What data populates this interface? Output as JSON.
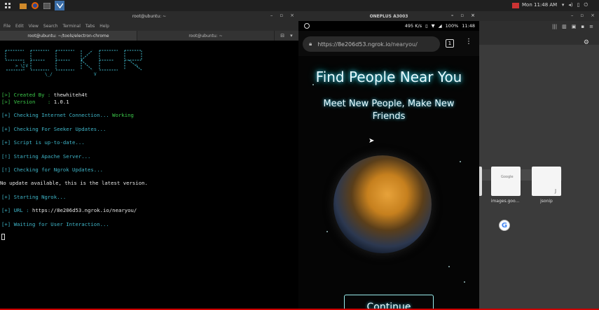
{
  "topbar": {
    "clock": "Mon 11:48 AM",
    "icons": [
      "apps-icon",
      "files-icon",
      "firefox-icon",
      "terminal-icon",
      "vpn-icon"
    ],
    "system_icons": [
      "network-icon",
      "volume-icon",
      "battery-icon",
      "power-icon"
    ]
  },
  "terminal": {
    "title": "root@ubuntu: ~",
    "menu": [
      "File",
      "Edit",
      "View",
      "Search",
      "Terminal",
      "Tabs",
      "Help"
    ],
    "tabs": [
      "root@ubuntu: ~/tools/electron-chrome",
      "root@ubuntu: ~"
    ],
    "banner": "seeker",
    "lines": [
      {
        "prefix": "[>]",
        "text": " Created By : ",
        "value": "thewhiteh4t",
        "color": "#3cc94a"
      },
      {
        "prefix": "[>]",
        "text": " Version    : ",
        "value": "1.0.1",
        "color": "#3cc94a"
      },
      {
        "prefix": "[+]",
        "text": " Checking Internet Connection... ",
        "value": "Working",
        "color": "#3fb6c9"
      },
      {
        "prefix": "[+]",
        "text": " Checking For Seeker Updates...",
        "value": "",
        "color": "#3fb6c9"
      },
      {
        "prefix": "[+]",
        "text": " Script is up-to-date...",
        "value": "",
        "color": "#3fb6c9"
      },
      {
        "prefix": "[!]",
        "text": " Starting Apache Server...",
        "value": "",
        "color": "#3fb6c9"
      },
      {
        "prefix": "[!]",
        "text": " Checking for Ngrok Updates...",
        "value": "",
        "color": "#3fb6c9"
      },
      {
        "prefix": "",
        "text": "No update available, this is the latest version.",
        "value": "",
        "color": "#e8e8e8"
      },
      {
        "prefix": "[+]",
        "text": " Starting Ngrok...",
        "value": "",
        "color": "#3fb6c9"
      },
      {
        "prefix": "[+]",
        "text": " URL : ",
        "value": "https://8e206d53.ngrok.io/nearyou/",
        "color": "#3fb6c9"
      },
      {
        "prefix": "[+]",
        "text": " Waiting for User Interaction...",
        "value": "",
        "color": "#3fb6c9"
      }
    ]
  },
  "phone": {
    "title": "ONEPLUS A3003",
    "status": {
      "speed": "495 K/s",
      "battery": "100%",
      "time": "11:48"
    },
    "url_host": "https://8e206d53.ngrok.io",
    "url_path": "/nearyou/",
    "tab_count": "1",
    "heading": "Find People Near You",
    "subheading": "Meet New People, Make New Friends",
    "button": "Continue"
  },
  "chrome": {
    "tiles": [
      {
        "caption": "images.goo..."
      },
      {
        "caption": "jsonip"
      }
    ]
  },
  "colors": {
    "accent_green": "#3cc94a",
    "accent_cyan": "#3fb6c9",
    "glow": "#3fd9ff"
  }
}
